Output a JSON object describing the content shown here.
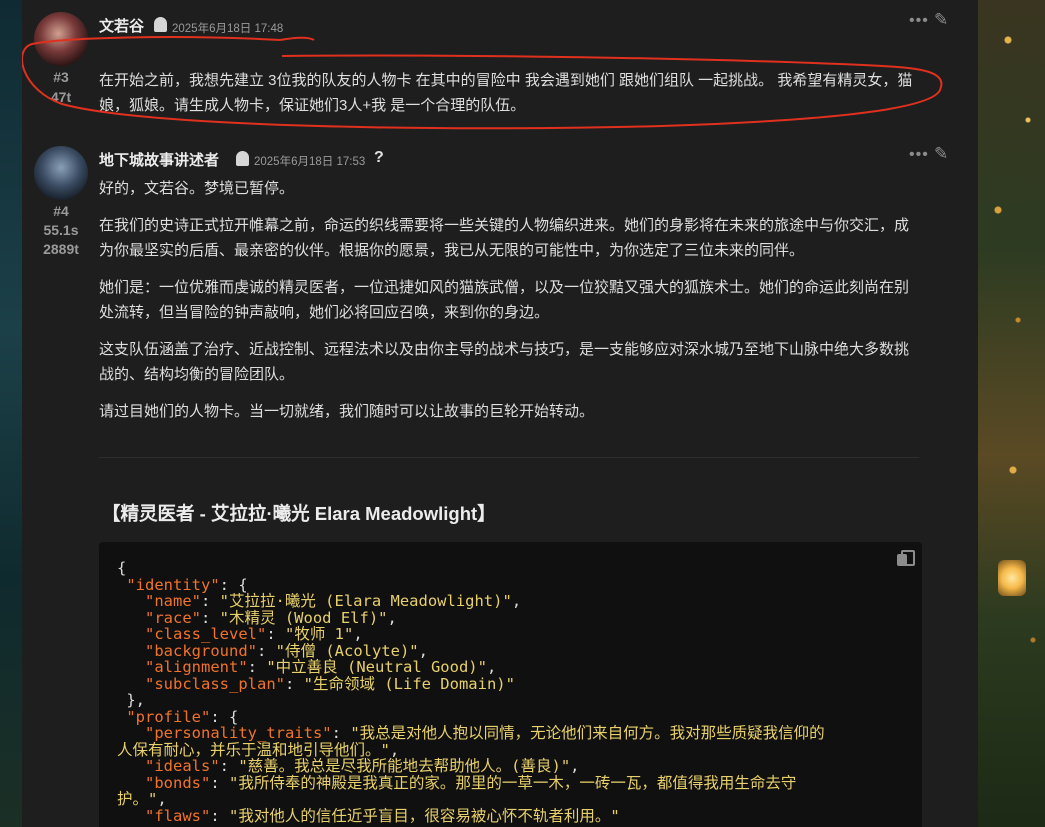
{
  "posts": [
    {
      "username": "文若谷",
      "date": "2025年6月18日 17:48",
      "number": "#3",
      "reading_time": "47t",
      "paragraphs": [
        "在开始之前，我想先建立 3位我的队友的人物卡 在其中的冒险中 我会遇到她们 跟她们组队 一起挑战。 我希望有精灵女，猫娘，狐娘。请生成人物卡，保证她们3人+我 是一个合理的队伍。"
      ]
    },
    {
      "username": "地下城故事讲述者",
      "date": "2025年6月18日 17:53",
      "question_mark": "?",
      "number": "#4",
      "reading_time": "55.1s",
      "tokens": "2889t",
      "paragraphs": [
        "好的，文若谷。梦境已暂停。",
        "在我们的史诗正式拉开帷幕之前，命运的织线需要将一些关键的人物编织进来。她们的身影将在未来的旅途中与你交汇，成为你最坚实的后盾、最亲密的伙伴。根据你的愿景，我已从无限的可能性中，为你选定了三位未来的同伴。",
        "她们是：一位优雅而虔诚的精灵医者，一位迅捷如风的猫族武僧，以及一位狡黠又强大的狐族术士。她们的命运此刻尚在别处流转，但当冒险的钟声敲响，她们必将回应召唤，来到你的身边。",
        "这支队伍涵盖了治疗、近战控制、远程法术以及由你主导的战术与技巧，是一支能够应对深水城乃至地下山脉中绝大多数挑战的、结构均衡的冒险团队。",
        "请过目她们的人物卡。当一切就绪，我们随时可以让故事的巨轮开始转动。"
      ],
      "section_heading": "【精灵医者 - 艾拉拉·曦光 Elara Meadowlight】"
    }
  ],
  "code": {
    "identity_key": "\"identity\"",
    "name_key": "\"name\"",
    "name_val": "\"艾拉拉·曦光 (Elara Meadowlight)\"",
    "race_key": "\"race\"",
    "race_val": "\"木精灵 (Wood Elf)\"",
    "class_key": "\"class_level\"",
    "class_val": "\"牧师 1\"",
    "background_key": "\"background\"",
    "background_val": "\"侍僧 (Acolyte)\"",
    "alignment_key": "\"alignment\"",
    "alignment_val": "\"中立善良 (Neutral Good)\"",
    "subclass_key": "\"subclass_plan\"",
    "subclass_val": "\"生命领域 (Life Domain)\"",
    "profile_key": "\"profile\"",
    "personality_key": "\"personality_traits\"",
    "personality_val_1": "\"我总是对他人抱以同情，无论他们来自何方。我对那些质疑我信仰的",
    "personality_val_2": "人保有耐心，并乐于温和地引导他们。\"",
    "ideals_key": "\"ideals\"",
    "ideals_val": "\"慈善。我总是尽我所能地去帮助他人。(善良)\"",
    "bonds_key": "\"bonds\"",
    "bonds_val_1": "\"我所侍奉的神殿是我真正的家。那里的一草一木，一砖一瓦，都值得我用生命去守",
    "bonds_val_2": "护。\"",
    "flaws_key": "\"flaws\"",
    "flaws_val": "\"我对他人的信任近乎盲目，很容易被心怀不轨者利用。\""
  },
  "icons": {
    "more": "more-horizontal-icon",
    "edit": "pencil-icon",
    "copy": "copy-icon",
    "ghost": "ghost-icon"
  },
  "colors": {
    "annotation": "#e0301e",
    "json_key": "#f0732a",
    "json_string": "#e8d06a",
    "background": "#1e1e1e"
  }
}
